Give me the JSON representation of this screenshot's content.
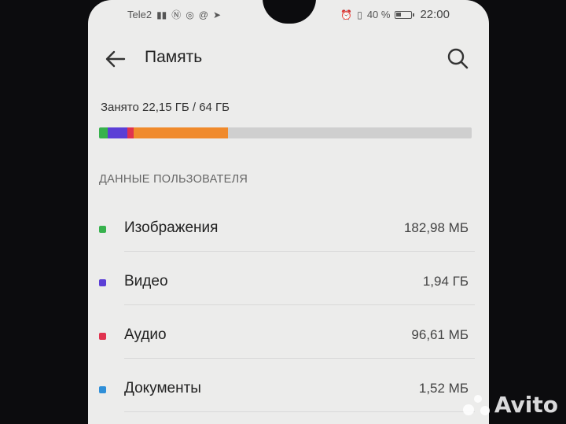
{
  "status_bar": {
    "carrier": "Tele2",
    "battery_percent": "40 %",
    "time": "22:00"
  },
  "header": {
    "title": "Память",
    "back_icon": "arrow-left-icon",
    "search_icon": "search-icon"
  },
  "storage": {
    "used_label": "Занято 22,15 ГБ / 64 ГБ",
    "used_fraction": 0.346,
    "bar_colors": {
      "images": "#37b24d",
      "video": "#5b3fd6",
      "audio": "#e0334f",
      "other": "#f08a2c",
      "free": "#cfcfcf"
    }
  },
  "user_data": {
    "section_title": "ДАННЫЕ ПОЛЬЗОВАТЕЛЯ",
    "items": [
      {
        "label": "Изображения",
        "size": "182,98 МБ",
        "color": "#37b24d"
      },
      {
        "label": "Видео",
        "size": "1,94 ГБ",
        "color": "#5b3fd6"
      },
      {
        "label": "Аудио",
        "size": "96,61 МБ",
        "color": "#e0334f"
      },
      {
        "label": "Документы",
        "size": "1,52 МБ",
        "color": "#2f8fd8"
      }
    ]
  },
  "watermark": {
    "text": "Avito"
  }
}
